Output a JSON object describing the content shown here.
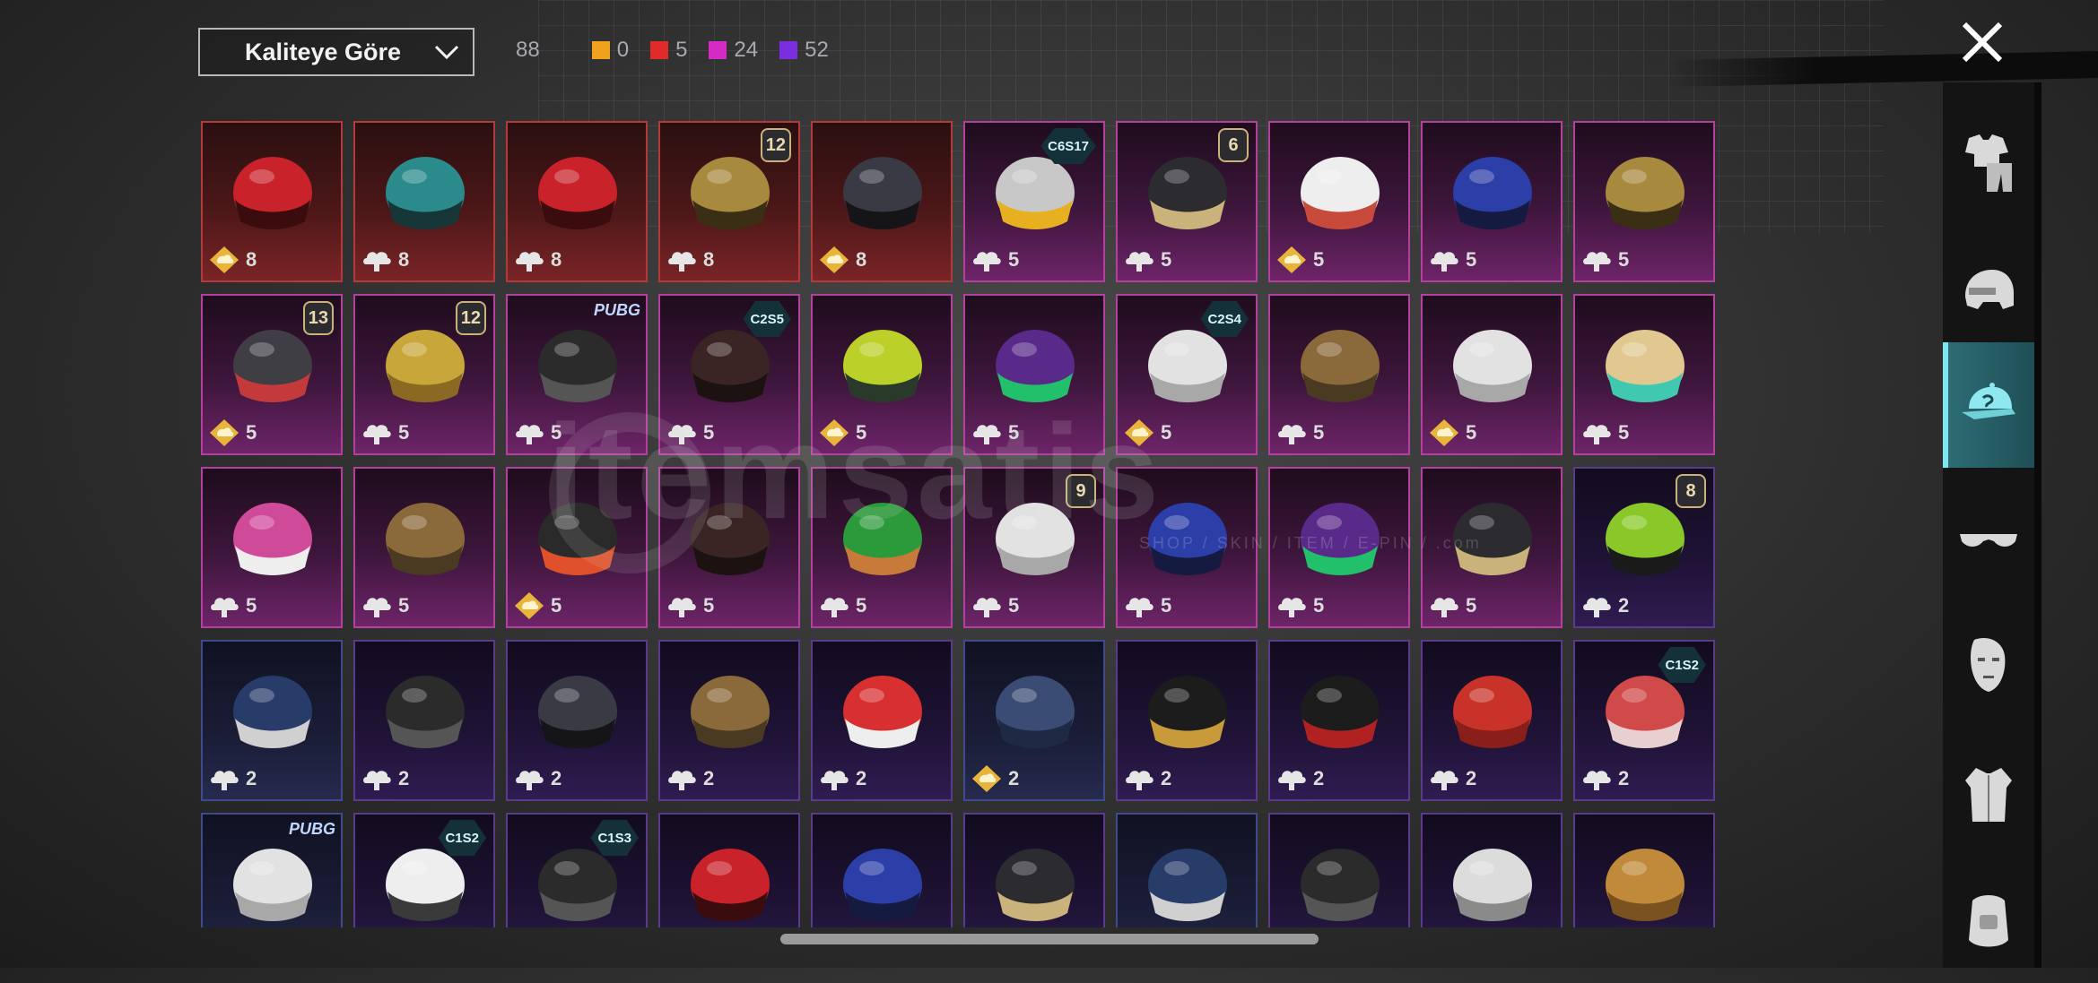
{
  "top_bar": {
    "sort_label": "Kaliteye Göre",
    "total_count": "88",
    "quality_counts": [
      {
        "color": "#f0a21e",
        "value": "0"
      },
      {
        "color": "#e12b2b",
        "value": "5"
      },
      {
        "color": "#d22cc4",
        "value": "24"
      },
      {
        "color": "#7a2ee0",
        "value": "52"
      }
    ]
  },
  "side_tabs": [
    {
      "name": "outfit",
      "icon": "outfit-icon",
      "active": false
    },
    {
      "name": "helmet",
      "icon": "helmet-icon",
      "active": false
    },
    {
      "name": "hat",
      "icon": "cap-icon",
      "active": true
    },
    {
      "name": "eyewear",
      "icon": "glasses-icon",
      "active": false
    },
    {
      "name": "face",
      "icon": "face-mask-icon",
      "active": false
    },
    {
      "name": "jacket",
      "icon": "jacket-icon",
      "active": false
    },
    {
      "name": "backpack",
      "icon": "backpack-icon",
      "active": false
    }
  ],
  "watermark": {
    "text": "itemsatis",
    "sub": "SHOP / SKIN / ITEM / E-PIN / .com"
  },
  "items": [
    {
      "tier": "red",
      "badge": "",
      "badge_type": "",
      "count": "8",
      "icon": "gold-cloud-icon",
      "art": "helmet-red"
    },
    {
      "tier": "red",
      "badge": "",
      "badge_type": "",
      "count": "8",
      "icon": "cloud-icon",
      "art": "helmet-teal"
    },
    {
      "tier": "red",
      "badge": "",
      "badge_type": "",
      "count": "8",
      "icon": "cloud-icon",
      "art": "helmet-red"
    },
    {
      "tier": "red",
      "badge": "12",
      "badge_type": "level",
      "count": "8",
      "icon": "cloud-icon",
      "art": "helmet-gold"
    },
    {
      "tier": "red",
      "badge": "",
      "badge_type": "",
      "count": "8",
      "icon": "gold-cloud-icon",
      "art": "helmet-dark"
    },
    {
      "tier": "pink",
      "badge": "C6S17",
      "badge_type": "season",
      "count": "5",
      "icon": "cloud-icon",
      "art": "cap-yellow"
    },
    {
      "tier": "pink",
      "badge": "6",
      "badge_type": "level",
      "count": "5",
      "icon": "cloud-icon",
      "art": "mask-dark"
    },
    {
      "tier": "pink",
      "badge": "",
      "badge_type": "",
      "count": "5",
      "icon": "gold-cloud-icon",
      "art": "hat-white"
    },
    {
      "tier": "pink",
      "badge": "",
      "badge_type": "",
      "count": "5",
      "icon": "cloud-icon",
      "art": "helmet-blue"
    },
    {
      "tier": "pink",
      "badge": "",
      "badge_type": "",
      "count": "5",
      "icon": "cloud-icon",
      "art": "helmet-gold"
    },
    {
      "tier": "pink",
      "badge": "13",
      "badge_type": "level",
      "count": "5",
      "icon": "gold-cloud-icon",
      "art": "cap-horns"
    },
    {
      "tier": "pink",
      "badge": "12",
      "badge_type": "level",
      "count": "5",
      "icon": "cloud-icon",
      "art": "mask-yellow"
    },
    {
      "tier": "pink",
      "badge": "PUBG",
      "badge_type": "tag",
      "count": "5",
      "icon": "cloud-icon",
      "art": "mask-gas"
    },
    {
      "tier": "pink",
      "badge": "C2S5",
      "badge_type": "season",
      "count": "5",
      "icon": "cloud-icon",
      "art": "hair-dark"
    },
    {
      "tier": "pink",
      "badge": "",
      "badge_type": "",
      "count": "5",
      "icon": "gold-cloud-icon",
      "art": "helmet-green"
    },
    {
      "tier": "pink",
      "badge": "",
      "badge_type": "",
      "count": "5",
      "icon": "cloud-icon",
      "art": "helmet-purple"
    },
    {
      "tier": "pink",
      "badge": "C2S4",
      "badge_type": "season",
      "count": "5",
      "icon": "gold-cloud-icon",
      "art": "hair-white"
    },
    {
      "tier": "pink",
      "badge": "",
      "badge_type": "",
      "count": "5",
      "icon": "cloud-icon",
      "art": "hat-brown"
    },
    {
      "tier": "pink",
      "badge": "",
      "badge_type": "",
      "count": "5",
      "icon": "gold-cloud-icon",
      "art": "hair-white"
    },
    {
      "tier": "pink",
      "badge": "",
      "badge_type": "",
      "count": "5",
      "icon": "cloud-icon",
      "art": "helmet-fox"
    },
    {
      "tier": "pink",
      "badge": "",
      "badge_type": "",
      "count": "5",
      "icon": "cloud-icon",
      "art": "helmet-pink"
    },
    {
      "tier": "pink",
      "badge": "",
      "badge_type": "",
      "count": "5",
      "icon": "cloud-icon",
      "art": "hat-brown"
    },
    {
      "tier": "pink",
      "badge": "",
      "badge_type": "",
      "count": "5",
      "icon": "gold-cloud-icon",
      "art": "visor-dark"
    },
    {
      "tier": "pink",
      "badge": "",
      "badge_type": "",
      "count": "5",
      "icon": "cloud-icon",
      "art": "hair-dark"
    },
    {
      "tier": "pink",
      "badge": "",
      "badge_type": "",
      "count": "5",
      "icon": "cloud-icon",
      "art": "frog-hat"
    },
    {
      "tier": "pink",
      "badge": "9",
      "badge_type": "level",
      "count": "5",
      "icon": "cloud-icon",
      "art": "hair-white"
    },
    {
      "tier": "pink",
      "badge": "",
      "badge_type": "",
      "count": "5",
      "icon": "cloud-icon",
      "art": "helmet-blue"
    },
    {
      "tier": "pink",
      "badge": "",
      "badge_type": "",
      "count": "5",
      "icon": "cloud-icon",
      "art": "helmet-purple"
    },
    {
      "tier": "pink",
      "badge": "",
      "badge_type": "",
      "count": "5",
      "icon": "cloud-icon",
      "art": "mask-dark"
    },
    {
      "tier": "purple",
      "badge": "8",
      "badge_type": "level",
      "count": "2",
      "icon": "cloud-icon",
      "art": "mask-green"
    },
    {
      "tier": "blue",
      "badge": "",
      "badge_type": "",
      "count": "2",
      "icon": "cloud-icon",
      "art": "cap-blue"
    },
    {
      "tier": "purple",
      "badge": "",
      "badge_type": "",
      "count": "2",
      "icon": "cloud-icon",
      "art": "mask-gas"
    },
    {
      "tier": "purple",
      "badge": "",
      "badge_type": "",
      "count": "2",
      "icon": "cloud-icon",
      "art": "helmet-dark"
    },
    {
      "tier": "purple",
      "badge": "",
      "badge_type": "",
      "count": "2",
      "icon": "cloud-icon",
      "art": "hat-brown"
    },
    {
      "tier": "purple",
      "badge": "",
      "badge_type": "",
      "count": "2",
      "icon": "cloud-icon",
      "art": "cap-red"
    },
    {
      "tier": "blue",
      "badge": "",
      "badge_type": "",
      "count": "2",
      "icon": "gold-cloud-icon",
      "art": "beanie-blue"
    },
    {
      "tier": "purple",
      "badge": "",
      "badge_type": "",
      "count": "2",
      "icon": "cloud-icon",
      "art": "cap-black"
    },
    {
      "tier": "purple",
      "badge": "",
      "badge_type": "",
      "count": "2",
      "icon": "cloud-icon",
      "art": "bucket-red"
    },
    {
      "tier": "purple",
      "badge": "",
      "badge_type": "",
      "count": "2",
      "icon": "cloud-icon",
      "art": "fez-red"
    },
    {
      "tier": "purple",
      "badge": "C1S2",
      "badge_type": "season",
      "count": "2",
      "icon": "cloud-icon",
      "art": "beanie-red"
    },
    {
      "tier": "blue",
      "badge": "PUBG",
      "badge_type": "tag",
      "count": "",
      "icon": "",
      "art": "hair-white"
    },
    {
      "tier": "purple",
      "badge": "C1S2",
      "badge_type": "season",
      "count": "",
      "icon": "",
      "art": "chef-hat"
    },
    {
      "tier": "purple",
      "badge": "C1S3",
      "badge_type": "season",
      "count": "",
      "icon": "",
      "art": "mask-gas"
    },
    {
      "tier": "purple",
      "badge": "",
      "badge_type": "",
      "count": "",
      "icon": "",
      "art": "helmet-red"
    },
    {
      "tier": "purple",
      "badge": "",
      "badge_type": "",
      "count": "",
      "icon": "",
      "art": "helmet-blue"
    },
    {
      "tier": "purple",
      "badge": "",
      "badge_type": "",
      "count": "",
      "icon": "",
      "art": "mask-dark"
    },
    {
      "tier": "blue",
      "badge": "",
      "badge_type": "",
      "count": "",
      "icon": "",
      "art": "cap-blue"
    },
    {
      "tier": "purple",
      "badge": "",
      "badge_type": "",
      "count": "",
      "icon": "",
      "art": "mask-gas"
    },
    {
      "tier": "purple",
      "badge": "",
      "badge_type": "",
      "count": "",
      "icon": "",
      "art": "helmet-white"
    },
    {
      "tier": "purple",
      "badge": "",
      "badge_type": "",
      "count": "",
      "icon": "",
      "art": "beanie-orange"
    }
  ]
}
